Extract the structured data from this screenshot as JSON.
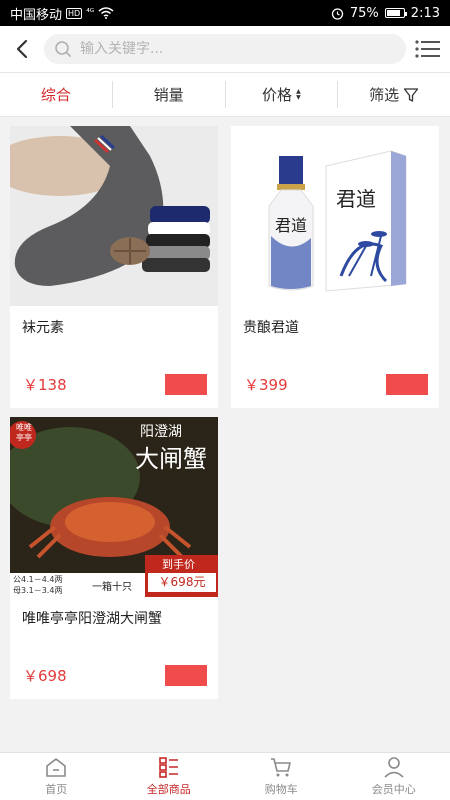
{
  "statusbar": {
    "carrier": "中国移动",
    "hd": "HD",
    "signal": "⁴ᴳ",
    "battery": "75%",
    "time": "2:13"
  },
  "search": {
    "placeholder": "输入关键字..."
  },
  "sort_tabs": [
    {
      "label": "综合",
      "active": true
    },
    {
      "label": "销量",
      "active": false
    },
    {
      "label": "价格",
      "active": false
    },
    {
      "label": "筛选",
      "active": false
    }
  ],
  "products": [
    {
      "name": "袜元素",
      "price": "￥138"
    },
    {
      "name": "贵酿君道",
      "price": "￥399"
    },
    {
      "name": "唯唯亭亭阳澄湖大闸蟹",
      "price": "￥698"
    }
  ],
  "crab_banner": {
    "brand_line1": "唯唯",
    "brand_line2": "亭亭",
    "title_small": "阳澄湖",
    "title_big": "大闸蟹",
    "spec_line1": "公4.1－4.4两",
    "spec_line2": "母3.1－3.4两",
    "box": "一箱十只",
    "price_label": "到手价",
    "price": "￥698元"
  },
  "bottle_label": "君道",
  "tabbar": [
    {
      "label": "首页",
      "icon": "home-icon",
      "active": false
    },
    {
      "label": "全部商品",
      "icon": "category-icon",
      "active": true
    },
    {
      "label": "购物车",
      "icon": "cart-icon",
      "active": false
    },
    {
      "label": "会员中心",
      "icon": "user-icon",
      "active": false
    }
  ],
  "colors": {
    "accent": "#d22b2b",
    "price": "#e33b3b",
    "cart_button": "#f04c4c"
  }
}
